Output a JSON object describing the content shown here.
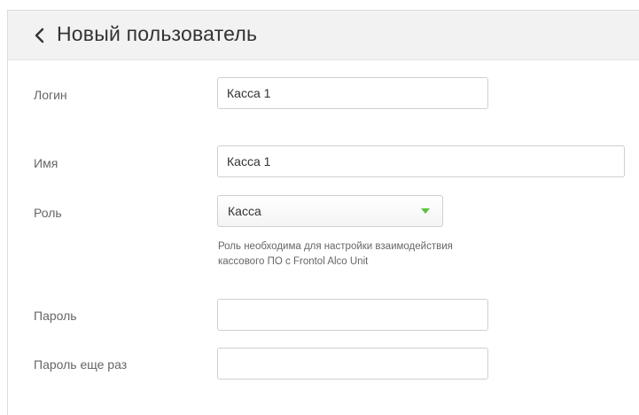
{
  "header": {
    "back_icon": "chevron-left-icon",
    "title": "Новый пользователь"
  },
  "form": {
    "login": {
      "label": "Логин",
      "value": "Касса 1"
    },
    "name": {
      "label": "Имя",
      "value": "Касса 1"
    },
    "role": {
      "label": "Роль",
      "selected": "Касса",
      "arrow_icon": "caret-down-icon",
      "arrow_color": "#5cc23e",
      "hint_line1": "Роль необходима для настройки взаимодействия",
      "hint_line2": "кассового ПО с Frontol Alco Unit"
    },
    "password": {
      "label": "Пароль",
      "value": ""
    },
    "password_repeat": {
      "label": "Пароль еще раз",
      "value": ""
    }
  }
}
